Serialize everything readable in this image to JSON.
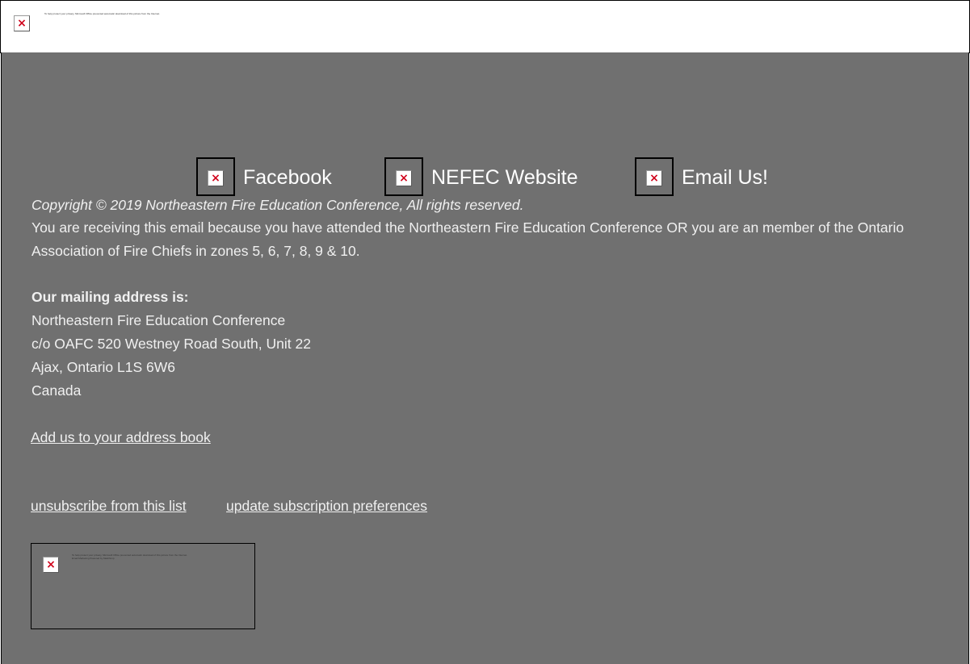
{
  "header_image": {
    "icon": "broken-image-icon",
    "alt_text": "To help protect your privacy, Microsoft Office prevented automatic download of this picture from the Internet."
  },
  "social": [
    {
      "label": "Facebook",
      "icon": "broken-image-icon"
    },
    {
      "label": "NEFEC Website",
      "icon": "broken-image-icon"
    },
    {
      "label": "Email Us!",
      "icon": "broken-image-icon"
    }
  ],
  "copyright": "Copyright © 2019 Northeastern Fire Education Conference, All rights reserved.",
  "notice": "You are receiving this email because you have attended the Northeastern Fire Education Conference OR you are an member of the Ontario Association of Fire Chiefs in zones 5, 6, 7, 8, 9 & 10.",
  "mailing": {
    "heading": "Our mailing address is:",
    "lines": [
      "Northeastern Fire Education Conference",
      "c/o OAFC 520 Westney Road South, Unit 22",
      "Ajax, Ontario L1S 6W6",
      "Canada"
    ]
  },
  "links": {
    "address_book": "Add us to your address book",
    "unsubscribe": "unsubscribe from this list",
    "preferences": "update subscription preferences"
  },
  "footer_badge": {
    "icon": "broken-image-icon",
    "alt_line1": "To help protect your privacy, Microsoft Office prevented automatic download of this picture from the Internet.",
    "alt_line2": "Email Marketing Powered by Mailchimp"
  },
  "colors": {
    "footer_background": "#707070",
    "text": "#f0f0f0",
    "broken_x": "#d0021b"
  }
}
